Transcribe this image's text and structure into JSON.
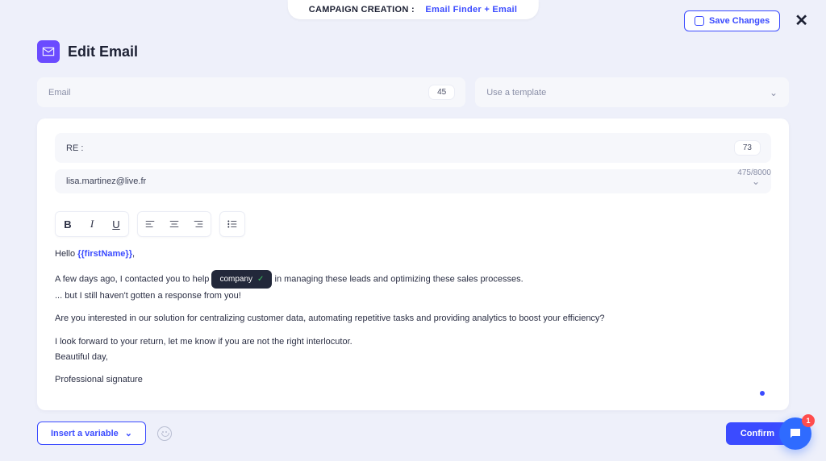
{
  "banner": {
    "label": "CAMPAIGN CREATION :",
    "crumb": "Email Finder + Email"
  },
  "actions": {
    "save": "Save Changes"
  },
  "page": {
    "title": "Edit Email"
  },
  "step": {
    "label": "Email",
    "count": "45"
  },
  "template": {
    "placeholder": "Use a template"
  },
  "subject": {
    "prefix": "RE :",
    "count": "73"
  },
  "from": {
    "email": "lisa.martinez@live.fr"
  },
  "char_counter": "475/8000",
  "body": {
    "greet_prefix": "Hello ",
    "greet_token": "{{firstName}}",
    "greet_suffix": ",",
    "l1_a": "A few days ago, I contacted you to help ",
    "chip": "company",
    "l1_b": " in managing these leads and optimizing these sales processes.",
    "l2": "... but I still haven't gotten a response from you!",
    "l3": "Are you interested in our solution for centralizing customer data, automating repetitive tasks and providing analytics to boost your efficiency?",
    "l4": "I look forward to your return, let me know if you are not the right interlocutor.",
    "l5": "Beautiful day,",
    "l6": "Professional signature"
  },
  "footer": {
    "insert_variable": "Insert a variable",
    "confirm": "Confirm"
  },
  "fab": {
    "badge": "1"
  }
}
